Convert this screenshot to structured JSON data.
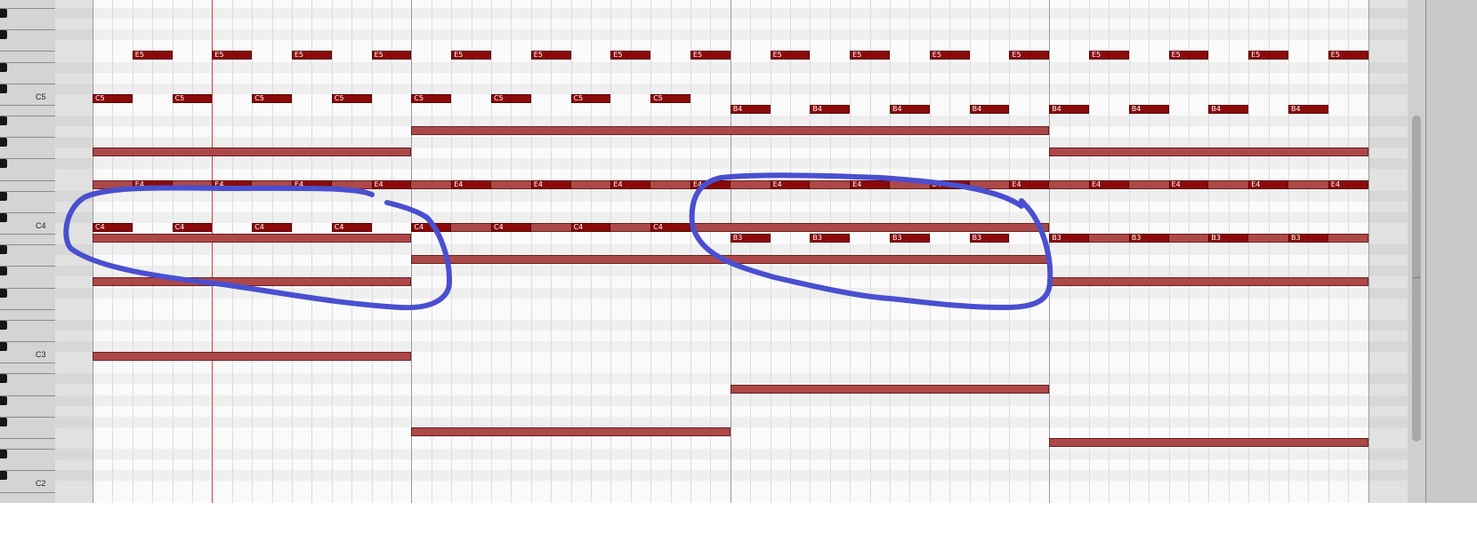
{
  "piano_roll": {
    "octave_labels": [
      "C5",
      "C4",
      "C3",
      "C2"
    ],
    "notes": [
      {
        "pitch": "E5",
        "beat": 2,
        "len": 2,
        "label": "E5",
        "style": "bright"
      },
      {
        "pitch": "E5",
        "beat": 6,
        "len": 2,
        "label": "E5",
        "style": "bright"
      },
      {
        "pitch": "E5",
        "beat": 10,
        "len": 2,
        "label": "E5",
        "style": "bright"
      },
      {
        "pitch": "E5",
        "beat": 14,
        "len": 2,
        "label": "E5",
        "style": "bright"
      },
      {
        "pitch": "E5",
        "beat": 18,
        "len": 2,
        "label": "E5",
        "style": "bright"
      },
      {
        "pitch": "E5",
        "beat": 22,
        "len": 2,
        "label": "E5",
        "style": "bright"
      },
      {
        "pitch": "E5",
        "beat": 26,
        "len": 2,
        "label": "E5",
        "style": "bright"
      },
      {
        "pitch": "E5",
        "beat": 30,
        "len": 2,
        "label": "E5",
        "style": "bright"
      },
      {
        "pitch": "E5",
        "beat": 34,
        "len": 2,
        "label": "E5",
        "style": "bright"
      },
      {
        "pitch": "E5",
        "beat": 38,
        "len": 2,
        "label": "E5",
        "style": "bright"
      },
      {
        "pitch": "E5",
        "beat": 42,
        "len": 2,
        "label": "E5",
        "style": "bright"
      },
      {
        "pitch": "E5",
        "beat": 46,
        "len": 2,
        "label": "E5",
        "style": "bright"
      },
      {
        "pitch": "E5",
        "beat": 50,
        "len": 2,
        "label": "E5",
        "style": "bright"
      },
      {
        "pitch": "E5",
        "beat": 54,
        "len": 2,
        "label": "E5",
        "style": "bright"
      },
      {
        "pitch": "E5",
        "beat": 58,
        "len": 2,
        "label": "E5",
        "style": "bright"
      },
      {
        "pitch": "E5",
        "beat": 62,
        "len": 2,
        "label": "E5",
        "style": "bright"
      },
      {
        "pitch": "C5",
        "beat": 0,
        "len": 2,
        "label": "C5",
        "style": "bright"
      },
      {
        "pitch": "C5",
        "beat": 4,
        "len": 2,
        "label": "C5",
        "style": "bright"
      },
      {
        "pitch": "C5",
        "beat": 8,
        "len": 2,
        "label": "C5",
        "style": "bright"
      },
      {
        "pitch": "C5",
        "beat": 12,
        "len": 2,
        "label": "C5",
        "style": "bright"
      },
      {
        "pitch": "C5",
        "beat": 16,
        "len": 2,
        "label": "C5",
        "style": "bright"
      },
      {
        "pitch": "C5",
        "beat": 20,
        "len": 2,
        "label": "C5",
        "style": "bright"
      },
      {
        "pitch": "C5",
        "beat": 24,
        "len": 2,
        "label": "C5",
        "style": "bright"
      },
      {
        "pitch": "C5",
        "beat": 28,
        "len": 2,
        "label": "C5",
        "style": "bright"
      },
      {
        "pitch": "B4",
        "beat": 32,
        "len": 2,
        "label": "B4",
        "style": "bright"
      },
      {
        "pitch": "B4",
        "beat": 36,
        "len": 2,
        "label": "B4",
        "style": "bright"
      },
      {
        "pitch": "B4",
        "beat": 40,
        "len": 2,
        "label": "B4",
        "style": "bright"
      },
      {
        "pitch": "B4",
        "beat": 44,
        "len": 2,
        "label": "B4",
        "style": "bright"
      },
      {
        "pitch": "B4",
        "beat": 48,
        "len": 2,
        "label": "B4",
        "style": "bright"
      },
      {
        "pitch": "B4",
        "beat": 52,
        "len": 2,
        "label": "B4",
        "style": "bright"
      },
      {
        "pitch": "B4",
        "beat": 56,
        "len": 2,
        "label": "B4",
        "style": "bright"
      },
      {
        "pitch": "B4",
        "beat": 60,
        "len": 2,
        "label": "B4",
        "style": "bright"
      },
      {
        "pitch": "A4",
        "beat": 16,
        "len": 32,
        "label": "",
        "style": "dim"
      },
      {
        "pitch": "G4",
        "beat": 0,
        "len": 16,
        "label": "",
        "style": "dim"
      },
      {
        "pitch": "G4",
        "beat": 48,
        "len": 16,
        "label": "",
        "style": "dim"
      },
      {
        "pitch": "E4",
        "beat": 0,
        "len": 64,
        "label": "",
        "style": "dim"
      },
      {
        "pitch": "E4",
        "beat": 2,
        "len": 2,
        "label": "E4",
        "style": "bright"
      },
      {
        "pitch": "E4",
        "beat": 6,
        "len": 2,
        "label": "E4",
        "style": "bright"
      },
      {
        "pitch": "E4",
        "beat": 10,
        "len": 2,
        "label": "E4",
        "style": "bright"
      },
      {
        "pitch": "E4",
        "beat": 14,
        "len": 2,
        "label": "E4",
        "style": "bright"
      },
      {
        "pitch": "E4",
        "beat": 18,
        "len": 2,
        "label": "E4",
        "style": "bright"
      },
      {
        "pitch": "E4",
        "beat": 22,
        "len": 2,
        "label": "E4",
        "style": "bright"
      },
      {
        "pitch": "E4",
        "beat": 26,
        "len": 2,
        "label": "E4",
        "style": "bright"
      },
      {
        "pitch": "E4",
        "beat": 30,
        "len": 2,
        "label": "E4",
        "style": "bright"
      },
      {
        "pitch": "E4",
        "beat": 34,
        "len": 2,
        "label": "E4",
        "style": "bright"
      },
      {
        "pitch": "E4",
        "beat": 38,
        "len": 2,
        "label": "E4",
        "style": "bright"
      },
      {
        "pitch": "E4",
        "beat": 42,
        "len": 2,
        "label": "E4",
        "style": "bright"
      },
      {
        "pitch": "E4",
        "beat": 46,
        "len": 2,
        "label": "E4",
        "style": "bright"
      },
      {
        "pitch": "E4",
        "beat": 50,
        "len": 2,
        "label": "E4",
        "style": "bright"
      },
      {
        "pitch": "E4",
        "beat": 54,
        "len": 2,
        "label": "E4",
        "style": "bright"
      },
      {
        "pitch": "E4",
        "beat": 58,
        "len": 2,
        "label": "E4",
        "style": "bright"
      },
      {
        "pitch": "E4",
        "beat": 62,
        "len": 2,
        "label": "E4",
        "style": "bright"
      },
      {
        "pitch": "C4",
        "beat": 16,
        "len": 32,
        "label": "",
        "style": "dim"
      },
      {
        "pitch": "C4",
        "beat": 0,
        "len": 2,
        "label": "C4",
        "style": "bright"
      },
      {
        "pitch": "C4",
        "beat": 4,
        "len": 2,
        "label": "C4",
        "style": "bright"
      },
      {
        "pitch": "C4",
        "beat": 8,
        "len": 2,
        "label": "C4",
        "style": "bright"
      },
      {
        "pitch": "C4",
        "beat": 12,
        "len": 2,
        "label": "C4",
        "style": "bright"
      },
      {
        "pitch": "C4",
        "beat": 16,
        "len": 2,
        "label": "C4",
        "style": "bright"
      },
      {
        "pitch": "C4",
        "beat": 20,
        "len": 2,
        "label": "C4",
        "style": "bright"
      },
      {
        "pitch": "C4",
        "beat": 24,
        "len": 2,
        "label": "C4",
        "style": "bright"
      },
      {
        "pitch": "C4",
        "beat": 28,
        "len": 2,
        "label": "C4",
        "style": "bright"
      },
      {
        "pitch": "B3",
        "beat": 0,
        "len": 16,
        "label": "",
        "style": "dim"
      },
      {
        "pitch": "B3",
        "beat": 48,
        "len": 16,
        "label": "",
        "style": "dim"
      },
      {
        "pitch": "B3",
        "beat": 32,
        "len": 2,
        "label": "B3",
        "style": "bright"
      },
      {
        "pitch": "B3",
        "beat": 36,
        "len": 2,
        "label": "B3",
        "style": "bright"
      },
      {
        "pitch": "B3",
        "beat": 40,
        "len": 2,
        "label": "B3",
        "style": "bright"
      },
      {
        "pitch": "B3",
        "beat": 44,
        "len": 2,
        "label": "B3",
        "style": "bright"
      },
      {
        "pitch": "B3",
        "beat": 48,
        "len": 2,
        "label": "B3",
        "style": "bright"
      },
      {
        "pitch": "B3",
        "beat": 52,
        "len": 2,
        "label": "B3",
        "style": "bright"
      },
      {
        "pitch": "B3",
        "beat": 56,
        "len": 2,
        "label": "B3",
        "style": "bright"
      },
      {
        "pitch": "B3",
        "beat": 60,
        "len": 2,
        "label": "B3",
        "style": "bright"
      },
      {
        "pitch": "A3",
        "beat": 16,
        "len": 32,
        "label": "",
        "style": "dim"
      },
      {
        "pitch": "G3",
        "beat": 0,
        "len": 16,
        "label": "",
        "style": "dim"
      },
      {
        "pitch": "G3",
        "beat": 48,
        "len": 16,
        "label": "",
        "style": "dim"
      },
      {
        "pitch": "C3",
        "beat": 0,
        "len": 16,
        "label": "",
        "style": "dim"
      },
      {
        "pitch": "A2",
        "beat": 32,
        "len": 16,
        "label": "",
        "style": "dim"
      },
      {
        "pitch": "F2",
        "beat": 16,
        "len": 16,
        "label": "",
        "style": "dim"
      },
      {
        "pitch": "E2",
        "beat": 48,
        "len": 16,
        "label": "",
        "style": "dim"
      }
    ],
    "colors": {
      "note_bright": "#8a0a0a",
      "note_dim": "#ad4848",
      "annotation_stroke": "#4a4fd0",
      "playhead": "#c64545"
    }
  }
}
